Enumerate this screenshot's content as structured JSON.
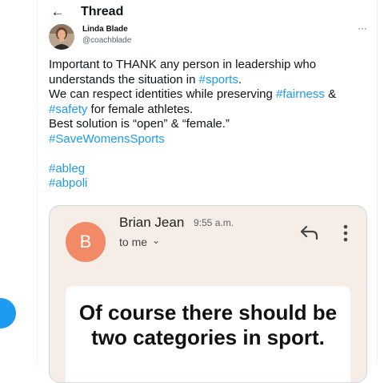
{
  "header": {
    "back_icon": "arrow-left-icon",
    "title": "Thread"
  },
  "author": {
    "name": "Linda Blade",
    "handle": "@coachblade",
    "more_label": "···"
  },
  "tweet": {
    "lines": [
      [
        {
          "t": "Important to THANK any person in leadership who"
        }
      ],
      [
        {
          "t": "understands the situation in "
        },
        {
          "t": "#sports",
          "tag": true
        },
        {
          "t": "."
        }
      ],
      [
        {
          "t": "We can respect identities while preserving "
        },
        {
          "t": "#fairness",
          "tag": true
        },
        {
          "t": " &"
        }
      ],
      [
        {
          "t": "#safety",
          "tag": true
        },
        {
          "t": " for female athletes."
        }
      ],
      [
        {
          "t": "Best solution is “open” & “female.”"
        }
      ],
      [
        {
          "t": "#SaveWomensSports",
          "tag": true
        }
      ],
      [],
      [
        {
          "t": "#ableg",
          "tag": true
        }
      ],
      [
        {
          "t": "#abpoli",
          "tag": true
        }
      ]
    ]
  },
  "email": {
    "avatar_letter": "B",
    "sender": "Brian Jean",
    "time": "9:55 a.m.",
    "recipient": "to me",
    "quote": [
      "Of course there should be",
      "two categories in sport."
    ]
  },
  "colors": {
    "link": "#1d9bf0",
    "avatar_orange": "#f28a67",
    "media_bg": "#f6ede6"
  }
}
